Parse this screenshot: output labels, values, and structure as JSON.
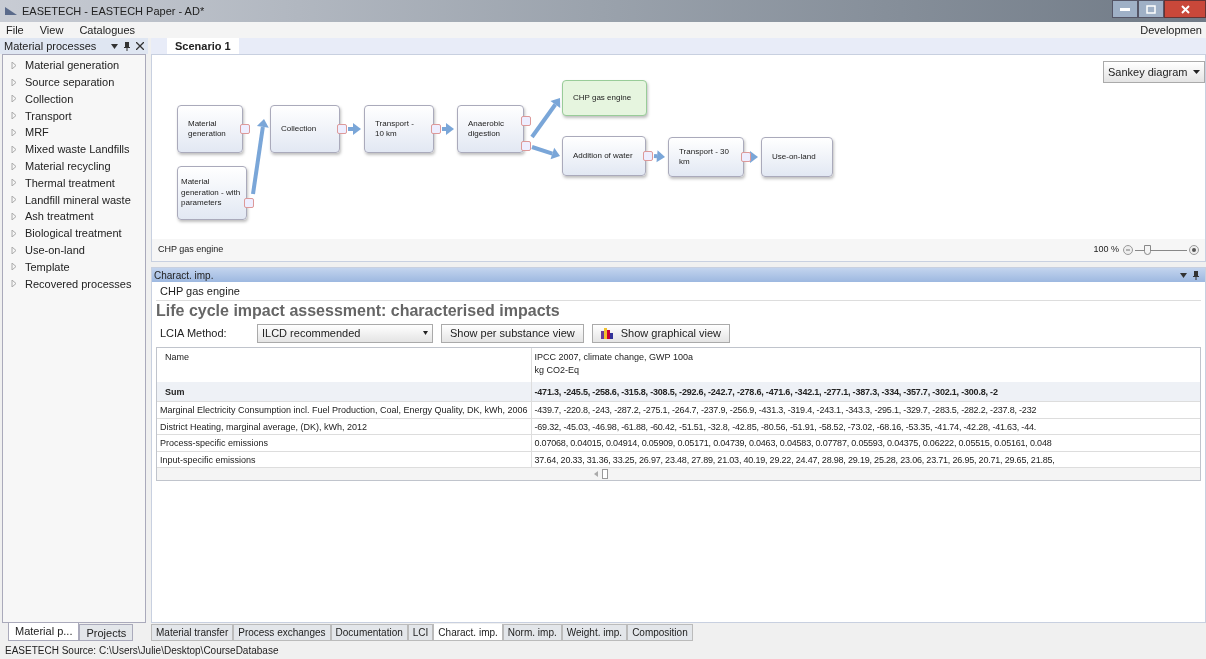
{
  "window": {
    "title": "EASETECH - EASTECH Paper - AD*"
  },
  "menu": [
    "File",
    "View",
    "Catalogues"
  ],
  "menu_right": "Developmen",
  "sidebar": {
    "title": "Material processes",
    "items": [
      {
        "label": "Material generation",
        "expanded": false
      },
      {
        "label": "Source separation",
        "expanded": false
      },
      {
        "label": "Collection",
        "expanded": false
      },
      {
        "label": "Transport",
        "expanded": false
      },
      {
        "label": "MRF",
        "expanded": false
      },
      {
        "label": "Mixed waste Landfills",
        "expanded": false
      },
      {
        "label": "Material recycling",
        "expanded": false
      },
      {
        "label": "Thermal treatment",
        "expanded": false
      },
      {
        "label": "Landfill mineral waste",
        "expanded": false
      },
      {
        "label": "Ash treatment",
        "expanded": false
      },
      {
        "label": "Biological treatment",
        "expanded": false
      },
      {
        "label": "Use-on-land",
        "expanded": false
      },
      {
        "label": "Template",
        "expanded": false
      },
      {
        "label": "Recovered processes",
        "expanded": false
      }
    ],
    "tabs": [
      {
        "label": "Material p...",
        "selected": true
      },
      {
        "label": "Projects",
        "selected": false
      }
    ]
  },
  "scenario": {
    "tabs": [
      {
        "label": "Scenario 1",
        "selected": true
      }
    ],
    "view_select": "Sankey diagram",
    "nodes": [
      {
        "label": "Material generation",
        "selected": false
      },
      {
        "label": "Material generation - with parameters",
        "selected": false
      },
      {
        "label": "Collection",
        "selected": false
      },
      {
        "label": "Transport - 10 km",
        "selected": false
      },
      {
        "label": "Anaerobic digestion",
        "selected": false
      },
      {
        "label": "CHP gas engine",
        "selected": true
      },
      {
        "label": "Addition of water",
        "selected": false
      },
      {
        "label": "Transport - 30 km",
        "selected": false
      },
      {
        "label": "Use-on-land",
        "selected": false
      }
    ],
    "selected_name": "CHP gas engine",
    "zoom": {
      "reading": "100 %",
      "level": 0.2
    }
  },
  "panel": {
    "title": "Charact. imp.",
    "process": "CHP gas engine",
    "heading": "Life cycle impact assessment: characterised impacts",
    "method_label": "LCIA Method:",
    "method": "ILCD recommended",
    "buttons": [
      "Show per substance view",
      "Show graphical view"
    ],
    "table": {
      "name_header": "Name",
      "category": "IPCC 2007, climate change, GWP 100a",
      "unit": "kg CO2-Eq",
      "sum": {
        "label": "Sum",
        "values": "-471.3, -245.5, -258.6, -315.8, -308.5, -292.6, -242.7, -278.6, -471.6, -342.1, -277.1, -387.3, -334, -357.7, -302.1, -300.8, -2"
      },
      "rows": [
        {
          "name": "Marginal Electricity Consumption incl. Fuel Production, Coal, Energy Quality, DK, kWh, 2006",
          "values": "-439.7, -220.8, -243, -287.2, -275.1, -264.7, -237.9, -256.9, -431.3, -319.4, -243.1, -343.3, -295.1, -329.7, -283.5, -282.2, -237.8, -232"
        },
        {
          "name": "District Heating, marginal average, (DK), kWh, 2012",
          "values": "-69.32, -45.03, -46.98, -61.88, -60.42, -51.51, -32.8, -42.85, -80.56, -51.91, -58.52, -73.02, -68.16, -53.35, -41.74, -42.28, -41.63, -44."
        },
        {
          "name": "Process-specific emissions",
          "values": "0.07068, 0.04015, 0.04914, 0.05909, 0.05171, 0.04739, 0.0463, 0.04583, 0.07787, 0.05593, 0.04375, 0.06222, 0.05515, 0.05161, 0.048"
        },
        {
          "name": "Input-specific emissions",
          "values": "37.64, 20.33, 31.36, 33.25, 26.97, 23.48, 27.89, 21.03, 40.19, 29.22, 24.47, 28.98, 29.19, 25.28, 23.06, 23.71, 26.95, 20.71, 29.65, 21.85,"
        }
      ]
    }
  },
  "bottom_tabs": [
    {
      "label": "Material transfer",
      "selected": false
    },
    {
      "label": "Process exchanges",
      "selected": false
    },
    {
      "label": "Documentation",
      "selected": false
    },
    {
      "label": "LCI",
      "selected": false
    },
    {
      "label": "Charact. imp.",
      "selected": true
    },
    {
      "label": "Norm. imp.",
      "selected": false
    },
    {
      "label": "Weight. imp.",
      "selected": false
    },
    {
      "label": "Composition",
      "selected": false
    }
  ],
  "status_bar": "EASETECH Source: C:\\Users\\Julie\\Desktop\\CourseDatabase"
}
